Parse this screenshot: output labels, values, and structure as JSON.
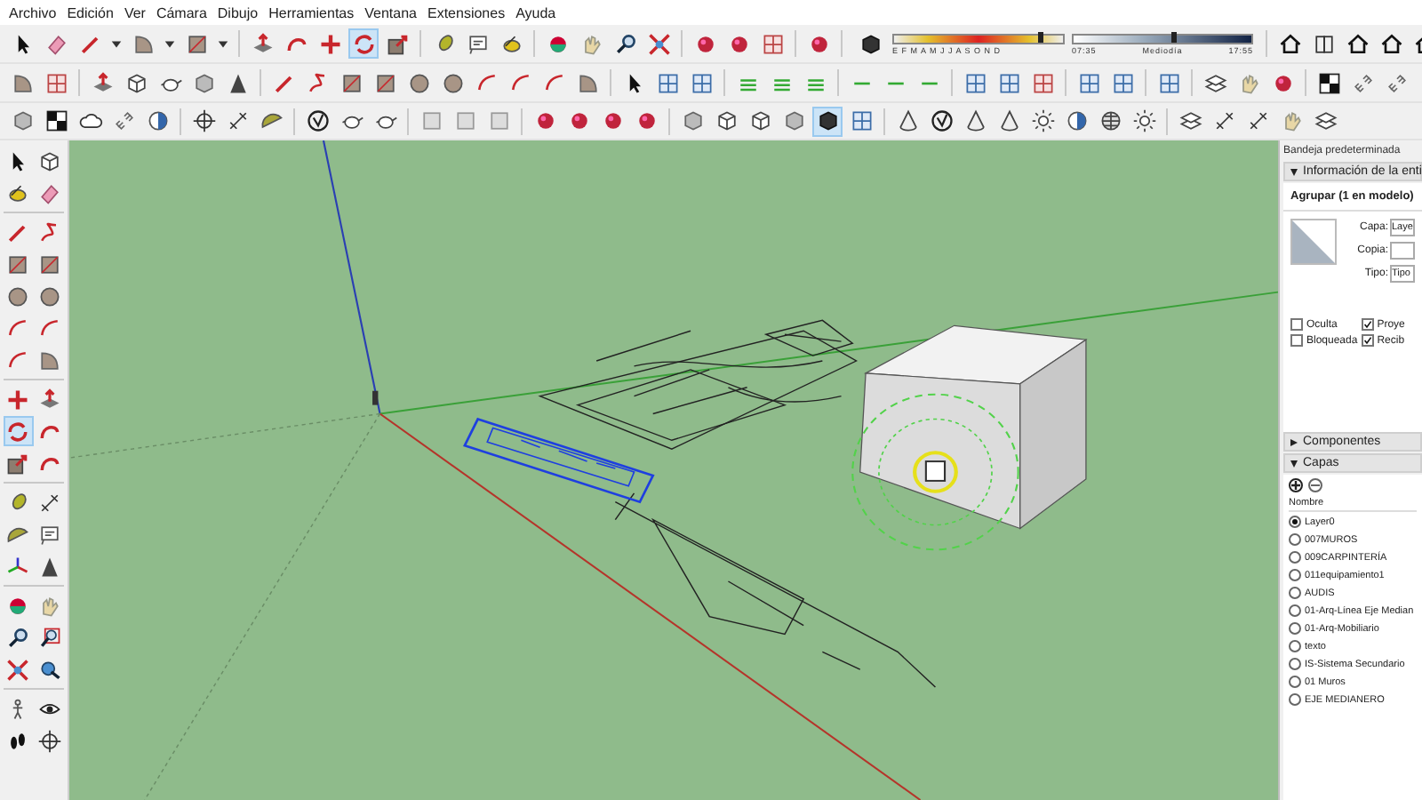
{
  "menu": [
    "Archivo",
    "Edición",
    "Ver",
    "Cámara",
    "Dibujo",
    "Herramientas",
    "Ventana",
    "Extensiones",
    "Ayuda"
  ],
  "tools": {
    "rotate_selected": true,
    "shaded_textures_selected": true
  },
  "shadow_settings": {
    "month_slider": {
      "level": 0.85
    },
    "time_slider": {
      "level": 0.55
    },
    "months": "E F M A M J J A S O N D",
    "time_start": "07:35",
    "time_mid": "Mediodía",
    "time_end": "17:55"
  },
  "tray": {
    "title": "Bandeja predeterminada",
    "entity_info": {
      "heading": "Información de la enti",
      "expanded": true,
      "summary": "Agrupar (1 en modelo)",
      "fields": [
        {
          "label": "Capa:",
          "value": "Laye"
        },
        {
          "label": "Copia:"
        },
        {
          "label": "Tipo:",
          "value": "Tipo"
        }
      ],
      "checkboxes": [
        {
          "label": "Oculta",
          "checked": false
        },
        {
          "label": "Proye",
          "checked": true
        },
        {
          "label": "Bloqueada",
          "checked": false
        },
        {
          "label": "Recib",
          "checked": true
        }
      ]
    },
    "components": {
      "heading": "Componentes",
      "expanded": false
    },
    "layers": {
      "heading": "Capas",
      "expanded": true,
      "column": "Nombre",
      "items": [
        {
          "name": "Layer0",
          "selected": true
        },
        {
          "name": "007MUROS",
          "selected": false
        },
        {
          "name": "009CARPINTERÍA",
          "selected": false
        },
        {
          "name": "011equipamiento1",
          "selected": false
        },
        {
          "name": "AUDIS",
          "selected": false
        },
        {
          "name": "01-Arq-Línea Eje Median",
          "selected": false
        },
        {
          "name": "01-Arq-Mobiliario",
          "selected": false
        },
        {
          "name": "texto",
          "selected": false
        },
        {
          "name": "IS-Sistema Secundario",
          "selected": false
        },
        {
          "name": "01 Muros",
          "selected": false
        },
        {
          "name": "EJE MEDIANERO",
          "selected": false
        }
      ]
    }
  }
}
